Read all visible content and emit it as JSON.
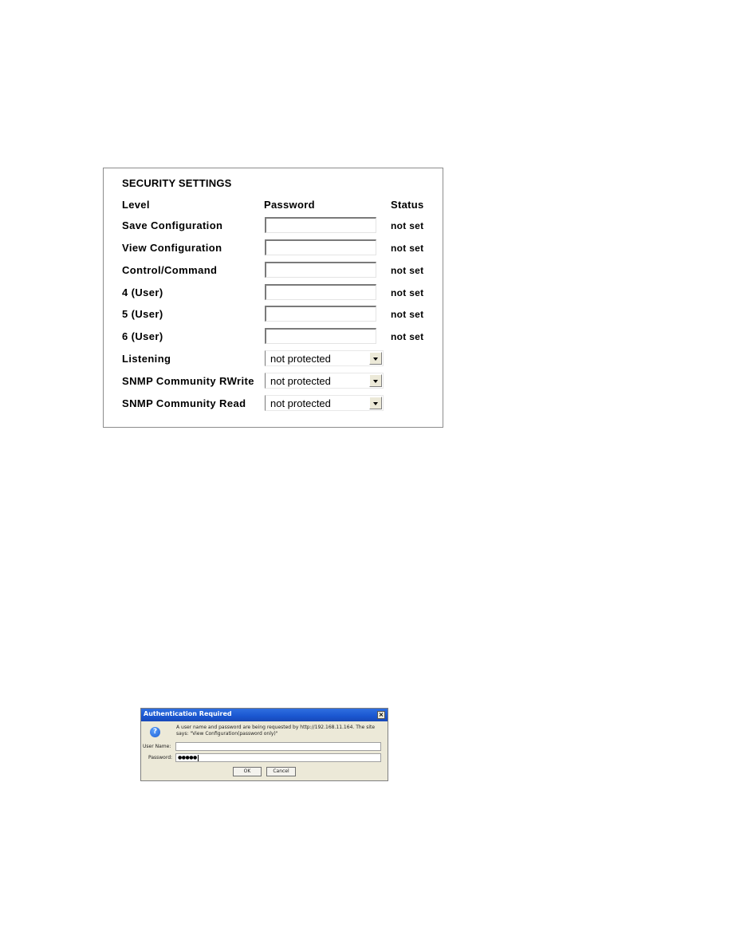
{
  "security_settings": {
    "title": "SECURITY SETTINGS",
    "headers": {
      "level": "Level",
      "password": "Password",
      "status": "Status"
    },
    "password_rows": [
      {
        "label": "Save Configuration",
        "password_value": "",
        "status": "not set"
      },
      {
        "label": "View Configuration",
        "password_value": "",
        "status": "not set"
      },
      {
        "label": "Control/Command",
        "password_value": "",
        "status": "not set"
      },
      {
        "label": "4 (User)",
        "password_value": "",
        "status": "not set"
      },
      {
        "label": "5 (User)",
        "password_value": "",
        "status": "not set"
      },
      {
        "label": "6 (User)",
        "password_value": "",
        "status": "not set"
      }
    ],
    "select_rows": [
      {
        "label": "Listening",
        "selected": "not protected"
      },
      {
        "label": "SNMP Community RWrite",
        "selected": "not protected"
      },
      {
        "label": "SNMP Community Read",
        "selected": "not protected"
      }
    ]
  },
  "auth_dialog": {
    "title": "Authentication Required",
    "close_glyph": "×",
    "help_icon_glyph": "?",
    "message": "A user name and password are being requested by http://192.168.11.164. The site says: \"View Configuration(password only)\"",
    "user_name_label": "User Name:",
    "user_name_value": "",
    "password_label": "Password:",
    "password_value": "●●●●●",
    "ok_label": "OK",
    "cancel_label": "Cancel",
    "colors": {
      "titlebar": "#1a56d0",
      "body": "#ece9d8"
    }
  }
}
